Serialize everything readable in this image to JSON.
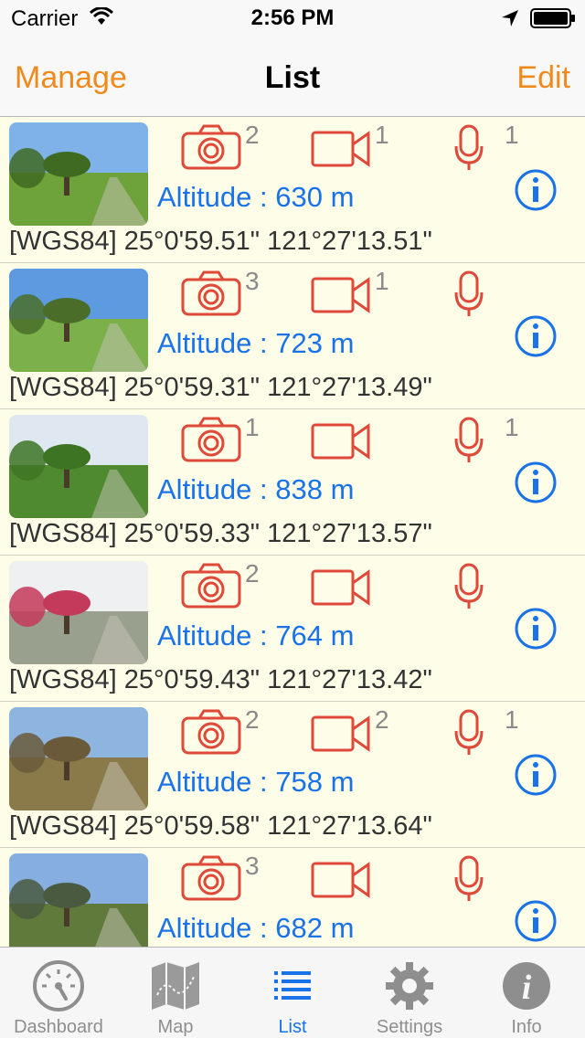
{
  "status": {
    "carrier": "Carrier",
    "time": "2:56 PM"
  },
  "nav": {
    "left": "Manage",
    "title": "List",
    "right": "Edit"
  },
  "items": [
    {
      "photos": "2",
      "videos": "1",
      "audio": "1",
      "altitude": "Altitude : 630 m",
      "coords": "[WGS84] 25°0'59.51\" 121°27'13.51\""
    },
    {
      "photos": "3",
      "videos": "1",
      "audio": "",
      "altitude": "Altitude : 723 m",
      "coords": "[WGS84] 25°0'59.31\" 121°27'13.49\""
    },
    {
      "photos": "1",
      "videos": "",
      "audio": "1",
      "altitude": "Altitude : 838 m",
      "coords": "[WGS84] 25°0'59.33\" 121°27'13.57\""
    },
    {
      "photos": "2",
      "videos": "",
      "audio": "",
      "altitude": "Altitude : 764 m",
      "coords": "[WGS84] 25°0'59.43\" 121°27'13.42\""
    },
    {
      "photos": "2",
      "videos": "2",
      "audio": "1",
      "altitude": "Altitude : 758 m",
      "coords": "[WGS84] 25°0'59.58\" 121°27'13.64\""
    },
    {
      "photos": "3",
      "videos": "",
      "audio": "",
      "altitude": "Altitude : 682 m",
      "coords": ""
    }
  ],
  "tabs": [
    {
      "label": "Dashboard",
      "icon": "gauge-icon"
    },
    {
      "label": "Map",
      "icon": "map-icon"
    },
    {
      "label": "List",
      "icon": "list-icon"
    },
    {
      "label": "Settings",
      "icon": "gear-icon"
    },
    {
      "label": "Info",
      "icon": "info-icon"
    }
  ],
  "colors": {
    "accent": "#f08a1c",
    "blue": "#1a72e8",
    "media": "#e0483a",
    "background": "#fdfde8"
  }
}
